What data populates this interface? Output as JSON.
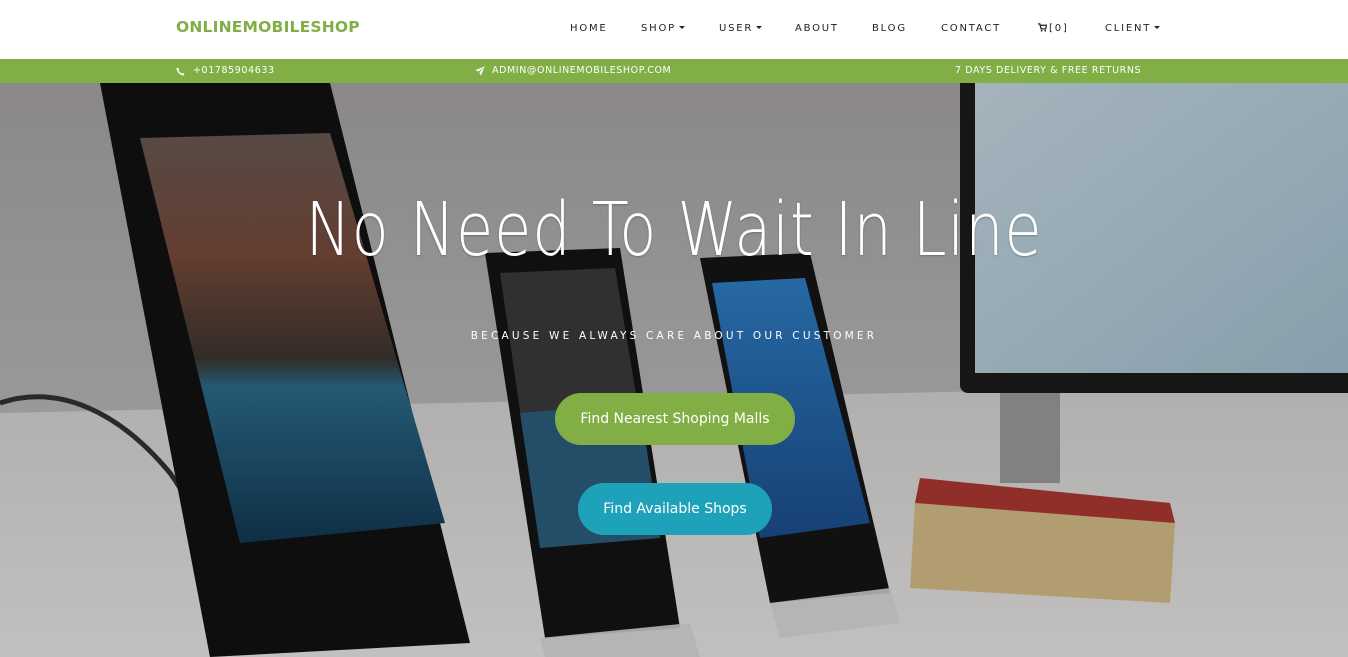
{
  "brand": "ONLINEMOBILESHOP",
  "nav": {
    "home": "HOME",
    "shop": "SHOP",
    "user": "USER",
    "about": "ABOUT",
    "blog": "BLOG",
    "contact": "CONTACT",
    "cart": "[0]",
    "client": "CLIENT"
  },
  "topbar": {
    "phone": "+01785904633",
    "email": "ADMIN@ONLINEMOBILESHOP.COM",
    "delivery": "7 DAYS DELIVERY & FREE RETURNS"
  },
  "hero": {
    "title": "No Need To Wait In Line",
    "subtitle": "BECAUSE WE ALWAYS CARE ABOUT OUR CUSTOMER",
    "btn_malls": "Find Nearest Shoping Malls",
    "btn_shops": "Find Available Shops"
  },
  "icons": {
    "phone": "phone-icon",
    "email": "paper-plane-icon",
    "cart": "cart-icon"
  },
  "colors": {
    "accent": "#82ae46",
    "secondary": "#1ea2ba"
  }
}
